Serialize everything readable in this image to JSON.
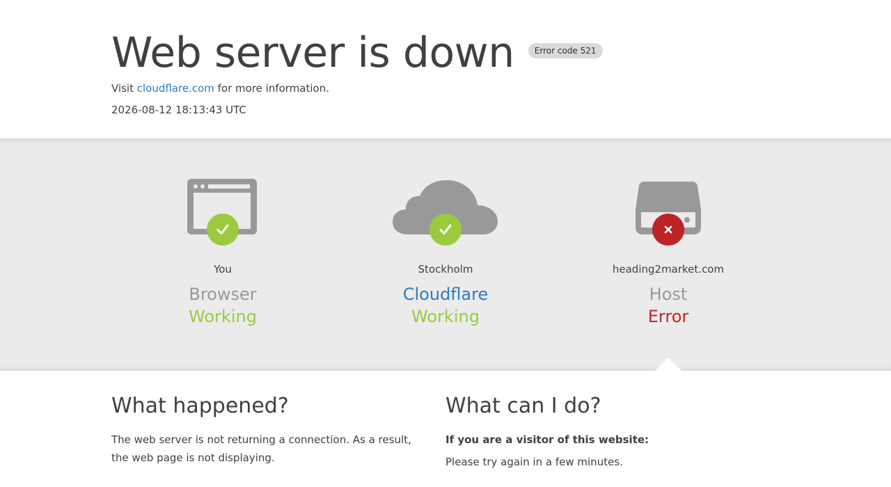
{
  "header": {
    "title": "Web server is down",
    "error_code": "Error code 521",
    "visit_prefix": "Visit ",
    "visit_link": "cloudflare.com",
    "visit_suffix": " for more information.",
    "timestamp": "2026-08-12 18:13:43 UTC"
  },
  "status": [
    {
      "location": "You",
      "role": "Browser",
      "state": "Working",
      "icon": "browser-icon",
      "badge": "check-icon"
    },
    {
      "location": "Stockholm",
      "role": "Cloudflare",
      "state": "Working",
      "icon": "cloud-icon",
      "badge": "check-icon"
    },
    {
      "location": "heading2market.com",
      "role": "Host",
      "state": "Error",
      "icon": "server-icon",
      "badge": "x-icon"
    }
  ],
  "colors": {
    "ok": "#9bca3e",
    "error": "#bd2426",
    "link": "#2f7bbf",
    "icon_gray": "#999999"
  },
  "details": {
    "what_happened_title": "What happened?",
    "what_happened_body": "The web server is not returning a connection. As a result, the web page is not displaying.",
    "what_can_i_do_title": "What can I do?",
    "visitor_heading": "If you are a visitor of this website:",
    "visitor_body": "Please try again in a few minutes."
  }
}
